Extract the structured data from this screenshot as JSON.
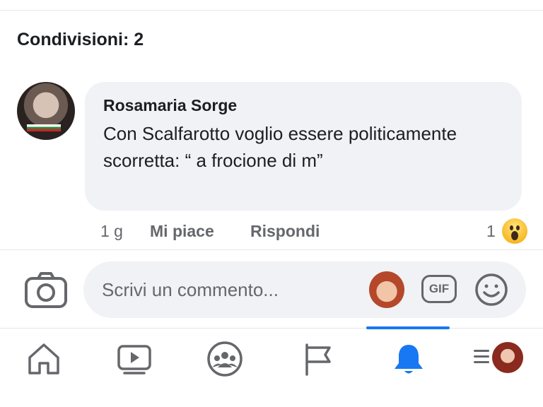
{
  "shares": {
    "label": "Condivisioni: 2"
  },
  "comment": {
    "author": "Rosamaria Sorge",
    "text": "Con Scalfarotto voglio essere politicamente scorretta: “ a frocione di m”",
    "time": "1 g",
    "like_label": "Mi piace",
    "reply_label": "Rispondi",
    "reaction_count": "1",
    "reaction_icon": "wow-emoji-icon"
  },
  "composer": {
    "placeholder": "Scrivi un commento...",
    "gif_label": "GIF",
    "camera_icon": "camera-icon",
    "emoji_icon": "emoji-icon"
  },
  "nav": {
    "items": [
      "home-icon",
      "video-icon",
      "groups-icon",
      "pages-flag-icon",
      "notifications-bell-icon",
      "menu-icon"
    ],
    "active": "notifications-bell-icon"
  },
  "colors": {
    "accent": "#1877f2",
    "bubble": "#f0f2f5",
    "muted": "#65676b"
  }
}
